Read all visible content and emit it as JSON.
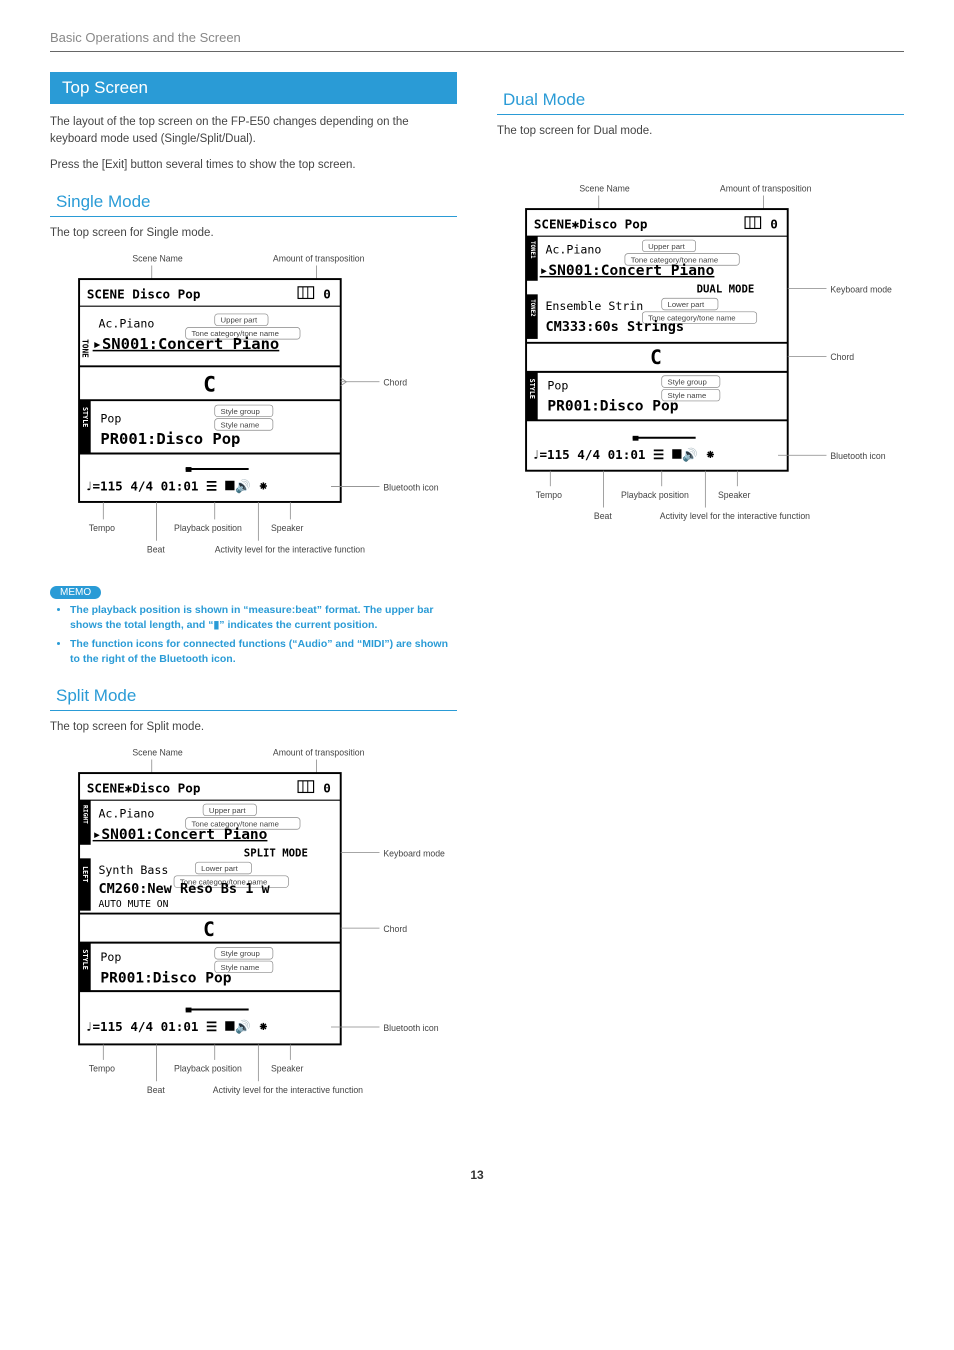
{
  "header": "Basic Operations and the Screen",
  "sectionTitle": "Top Screen",
  "intro1": "The layout of the top screen on the FP-E50 changes depending on the keyboard mode used (Single/Split/Dual).",
  "intro2": "Press the [Exit] button several times to show the top screen.",
  "single": {
    "title": "Single Mode",
    "lead": "The top screen for Single mode.",
    "labels": {
      "sceneName": "Scene Name",
      "transpose": "Amount of transposition",
      "upperPart": "Upper part",
      "toneCat": "Tone category/tone name",
      "chord": "Chord",
      "styleGroup": "Style group",
      "styleName": "Style name",
      "btIcon": "Bluetooth icon",
      "tempo": "Tempo",
      "playback": "Playback position",
      "speaker": "Speaker",
      "beat": "Beat",
      "activity": "Activity level for the interactive function"
    },
    "screen": {
      "sceneRow": "SCENE  Disco Pop",
      "transVal": "0",
      "toneSide": "TONE",
      "toneSmall": "Ac.Piano",
      "toneBig": "▸SN001:Concert Piano",
      "chordVal": "C",
      "styleSide": "STYLE",
      "styleSmall": "Pop",
      "styleBig": "PR001:Disco Pop",
      "bottom": "♩=115  4/4   01:01 ☰  ⯀🔊 ⁕"
    }
  },
  "memo": {
    "title": "MEMO",
    "b1": "The playback position is shown in “measure:beat” format. The upper bar shows the total length, and “▮” indicates the current position.",
    "b2": "The function icons for connected functions (“Audio” and “MIDI”) are shown to the right of the Bluetooth icon."
  },
  "split": {
    "title": "Split Mode",
    "lead": "The top screen for Split mode.",
    "labels": {
      "sceneName": "Scene Name",
      "transpose": "Amount of transposition",
      "upperPart": "Upper part",
      "toneCat": "Tone category/tone name",
      "kbMode": "Keyboard mode",
      "lowerPart": "Lower part",
      "chord": "Chord",
      "styleGroup": "Style group",
      "styleName": "Style name",
      "btIcon": "Bluetooth icon",
      "tempo": "Tempo",
      "playback": "Playback position",
      "speaker": "Speaker",
      "beat": "Beat",
      "activity": "Activity level for the interactive function"
    },
    "screen": {
      "sceneRow": "SCENE✱Disco Pop",
      "transVal": "0",
      "rightSide": "RIGHT",
      "toneSmall": "Ac.Piano",
      "toneBig": "▸SN001:Concert Piano",
      "modeRow": "SPLIT MODE",
      "leftSide": "LEFT",
      "lowerSmall": "Synth Bass",
      "lowerBig": "CM260:New Reso Bs 1 w",
      "autoMute": "AUTO MUTE ON",
      "chordVal": "C",
      "styleSide": "STYLE",
      "styleSmall": "Pop",
      "styleBig": "PR001:Disco Pop",
      "bottom": "♩=115  4/4   01:01 ☰  ⯀🔊 ⁕"
    }
  },
  "dual": {
    "title": "Dual Mode",
    "lead": "The top screen for Dual mode.",
    "labels": {
      "sceneName": "Scene Name",
      "transpose": "Amount of transposition",
      "upperPart": "Upper part",
      "toneCat": "Tone category/tone name",
      "kbMode": "Keyboard mode",
      "lowerPart": "Lower part",
      "chord": "Chord",
      "styleGroup": "Style group",
      "styleName": "Style name",
      "btIcon": "Bluetooth icon",
      "tempo": "Tempo",
      "playback": "Playback position",
      "speaker": "Speaker",
      "beat": "Beat",
      "activity": "Activity level for the interactive function"
    },
    "screen": {
      "sceneRow": "SCENE✱Disco Pop",
      "transVal": "0",
      "tone1Side": "TONE1",
      "toneSmall": "Ac.Piano",
      "toneBig": "▸SN001:Concert Piano",
      "modeRow": "DUAL MODE",
      "tone2Side": "TONE2",
      "lowerSmall": "Ensemble Strin",
      "lowerBig": "CM333:60s Strings",
      "chordVal": "C",
      "styleSide": "STYLE",
      "styleSmall": "Pop",
      "styleBig": "PR001:Disco Pop",
      "bottom": "♩=115  4/4   01:01 ☰  ⯀🔊 ⁕"
    }
  },
  "pageNum": "13"
}
